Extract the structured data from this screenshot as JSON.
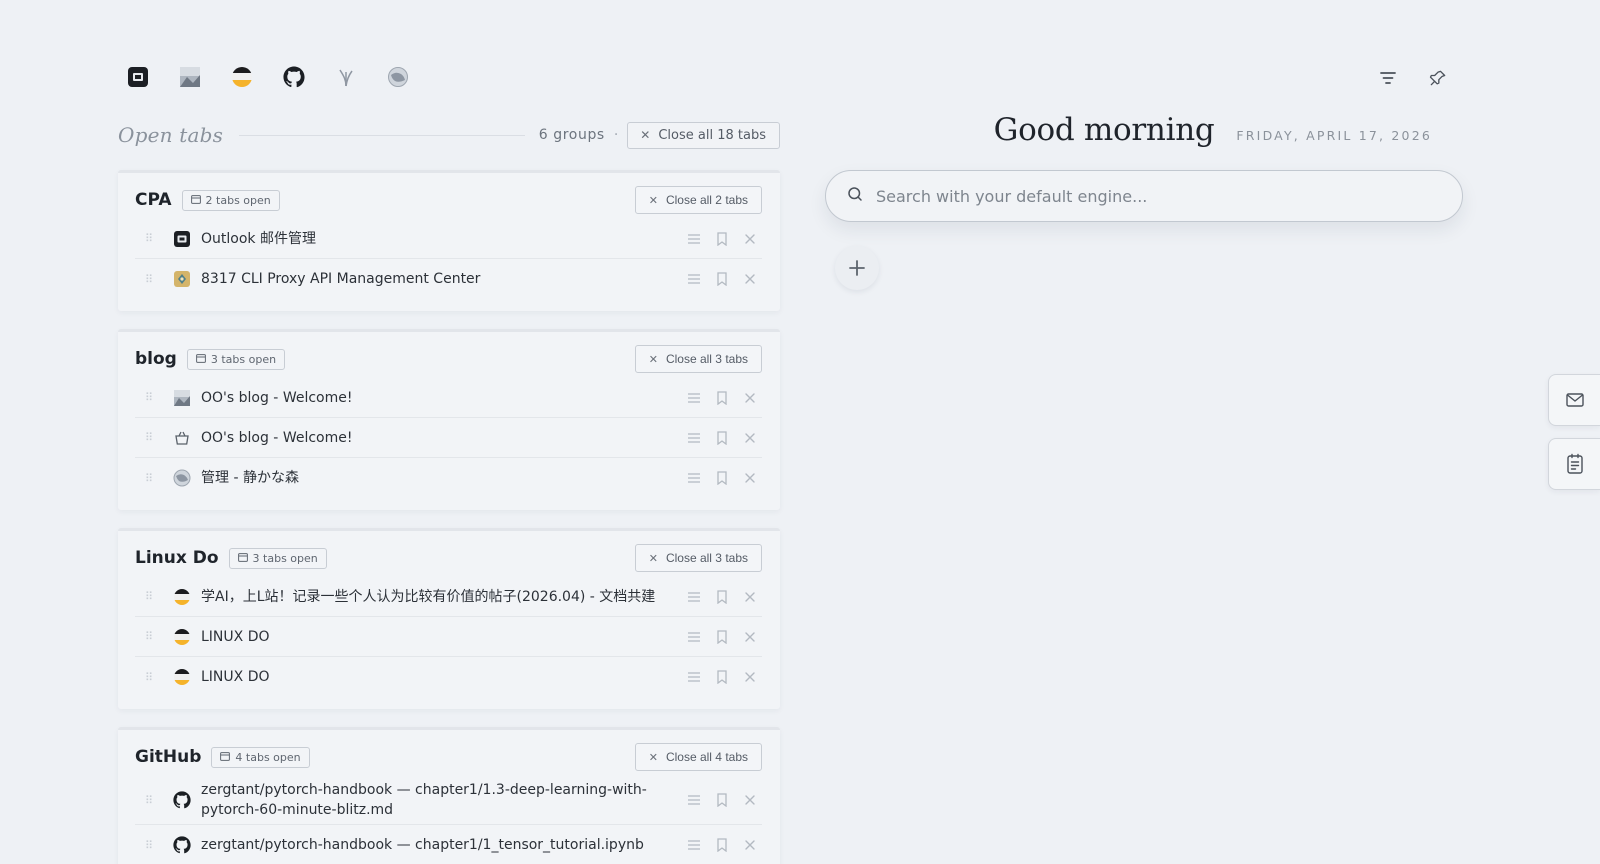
{
  "favicons": [
    {
      "name": "outlook-favicon",
      "icon": "mail-square-icon"
    },
    {
      "name": "blog-photo-favicon",
      "icon": "photo-icon"
    },
    {
      "name": "linuxdo-favicon",
      "icon": "linuxdo-icon"
    },
    {
      "name": "github-favicon",
      "icon": "github-icon"
    },
    {
      "name": "plant-favicon",
      "icon": "plant-icon"
    },
    {
      "name": "globe-favicon",
      "icon": "globe-icon"
    }
  ],
  "top_actions": {
    "filter_icon": "filter-icon",
    "pin_icon": "pin-icon"
  },
  "open_tabs": {
    "title": "Open tabs",
    "groups_count": "6 groups",
    "separator": "·",
    "close_all_label": "Close all 18 tabs"
  },
  "groups": [
    {
      "name": "CPA",
      "badge": "2 tabs open",
      "close_label": "Close all 2 tabs",
      "tabs": [
        {
          "title": "Outlook 邮件管理",
          "icon": "mail-square-icon"
        },
        {
          "title": "8317 CLI Proxy API Management Center",
          "icon": "proxy-icon"
        }
      ]
    },
    {
      "name": "blog",
      "badge": "3 tabs open",
      "close_label": "Close all 3 tabs",
      "tabs": [
        {
          "title": "OO's blog - Welcome!",
          "icon": "photo-icon"
        },
        {
          "title": "OO's blog - Welcome!",
          "icon": "basket-icon"
        },
        {
          "title": "管理 - 静かな森",
          "icon": "globe-icon"
        }
      ]
    },
    {
      "name": "Linux Do",
      "badge": "3 tabs open",
      "close_label": "Close all 3 tabs",
      "tabs": [
        {
          "title": "学AI，上L站！记录一些个人认为比较有价值的帖子(2026.04) - 文档共建",
          "icon": "linuxdo-icon"
        },
        {
          "title": "LINUX DO",
          "icon": "linuxdo-icon"
        },
        {
          "title": "LINUX DO",
          "icon": "linuxdo-icon"
        }
      ]
    },
    {
      "name": "GitHub",
      "badge": "4 tabs open",
      "close_label": "Close all 4 tabs",
      "tabs": [
        {
          "title": "zergtant/pytorch-handbook — chapter1/1.3-deep-learning-with-pytorch-60-minute-blitz.md",
          "icon": "github-icon"
        },
        {
          "title": "zergtant/pytorch-handbook — chapter1/1_tensor_tutorial.ipynb",
          "icon": "github-icon"
        }
      ]
    }
  ],
  "greeting": "Good morning",
  "date": "FRIDAY, APRIL 17, 2026",
  "search": {
    "placeholder": "Search with your default engine..."
  },
  "side_buttons": [
    "mail-icon",
    "notes-icon"
  ]
}
